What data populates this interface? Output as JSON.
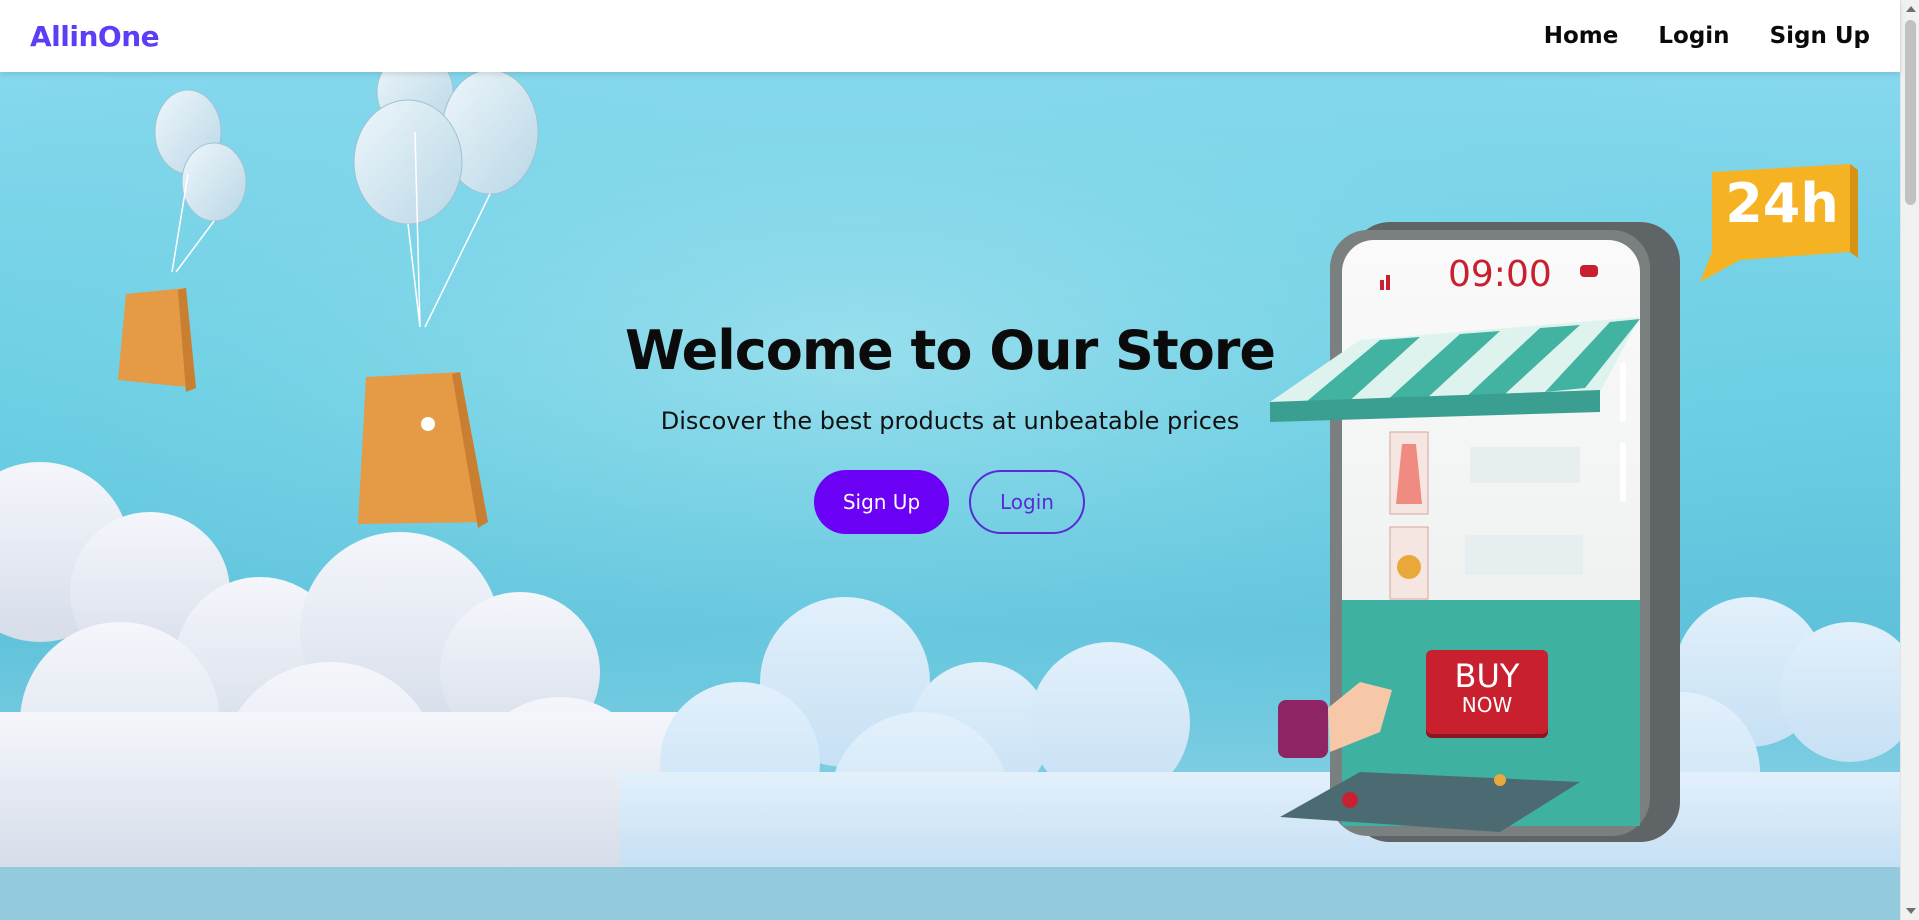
{
  "navbar": {
    "brand": "AllinOne",
    "links": [
      {
        "label": "Home"
      },
      {
        "label": "Login"
      },
      {
        "label": "Sign Up"
      }
    ]
  },
  "hero": {
    "title": "Welcome to Our Store",
    "subtitle": "Discover the best products at unbeatable prices",
    "signup_label": "Sign Up",
    "login_label": "Login"
  },
  "illustration": {
    "phone_time": "09:00",
    "badge_text": "24h",
    "buy_label": "BUY",
    "buy_sublabel": "NOW"
  },
  "colors": {
    "brand": "#5b3ef5",
    "primary_button": "#6a00f4",
    "sky": "#6ccfe3",
    "awning": "#43b3a1",
    "buy_button": "#c8202f",
    "badge": "#f5b223"
  }
}
